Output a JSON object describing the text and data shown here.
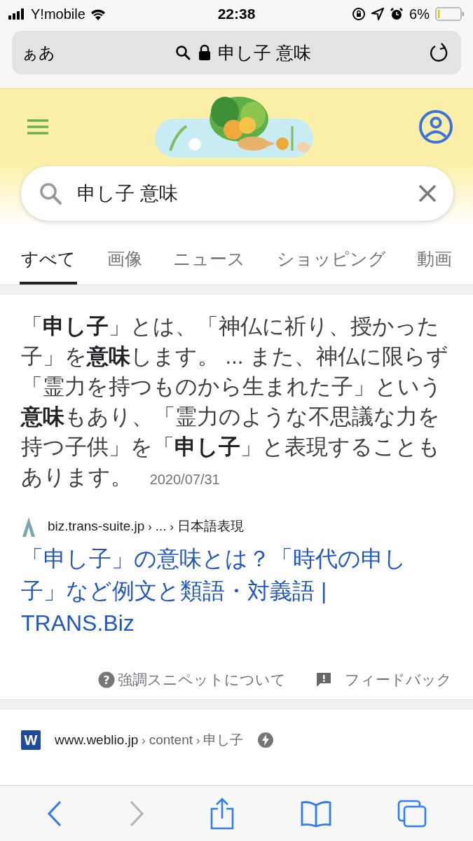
{
  "status_bar": {
    "carrier": "Y!mobile",
    "time": "22:38",
    "battery": "6%"
  },
  "address_bar": {
    "text_size": "ぁあ",
    "query": "申し子 意味"
  },
  "search": {
    "value": "申し子 意味"
  },
  "tabs": [
    {
      "label": "すべて",
      "selected": true
    },
    {
      "label": "画像",
      "selected": false
    },
    {
      "label": "ニュース",
      "selected": false
    },
    {
      "label": "ショッピング",
      "selected": false
    },
    {
      "label": "動画",
      "selected": false
    }
  ],
  "featured_snippet": {
    "text": "「**申し子**」とは、「神仏に祈り、授かった子」を**意味**します。 ... また、神仏に限らず「霊力を持つものから生まれた子」という**意味**もあり、「霊力のような不思議な力を持つ子供」を「**申し子**」と表現することもあります。",
    "date": "2020/07/31",
    "source": {
      "site": "biz.trans-suite.jp",
      "path": [
        {
          "sep": "›",
          "text": "..."
        },
        {
          "sep": "›",
          "text": "日本語表現"
        }
      ]
    },
    "title": "「申し子」の意味とは？「時代の申し子」など例文と類語・対義語 | TRANS.Biz",
    "about_icon": "?",
    "about": "強調スニペットについて",
    "feedback": "フィードバック"
  },
  "results": [
    {
      "favicon": "W",
      "site": "www.weblio.jp",
      "path": [
        {
          "sep": "›",
          "text": "content"
        },
        {
          "sep": "›",
          "text": "申し子"
        }
      ],
      "amp": true
    }
  ]
}
